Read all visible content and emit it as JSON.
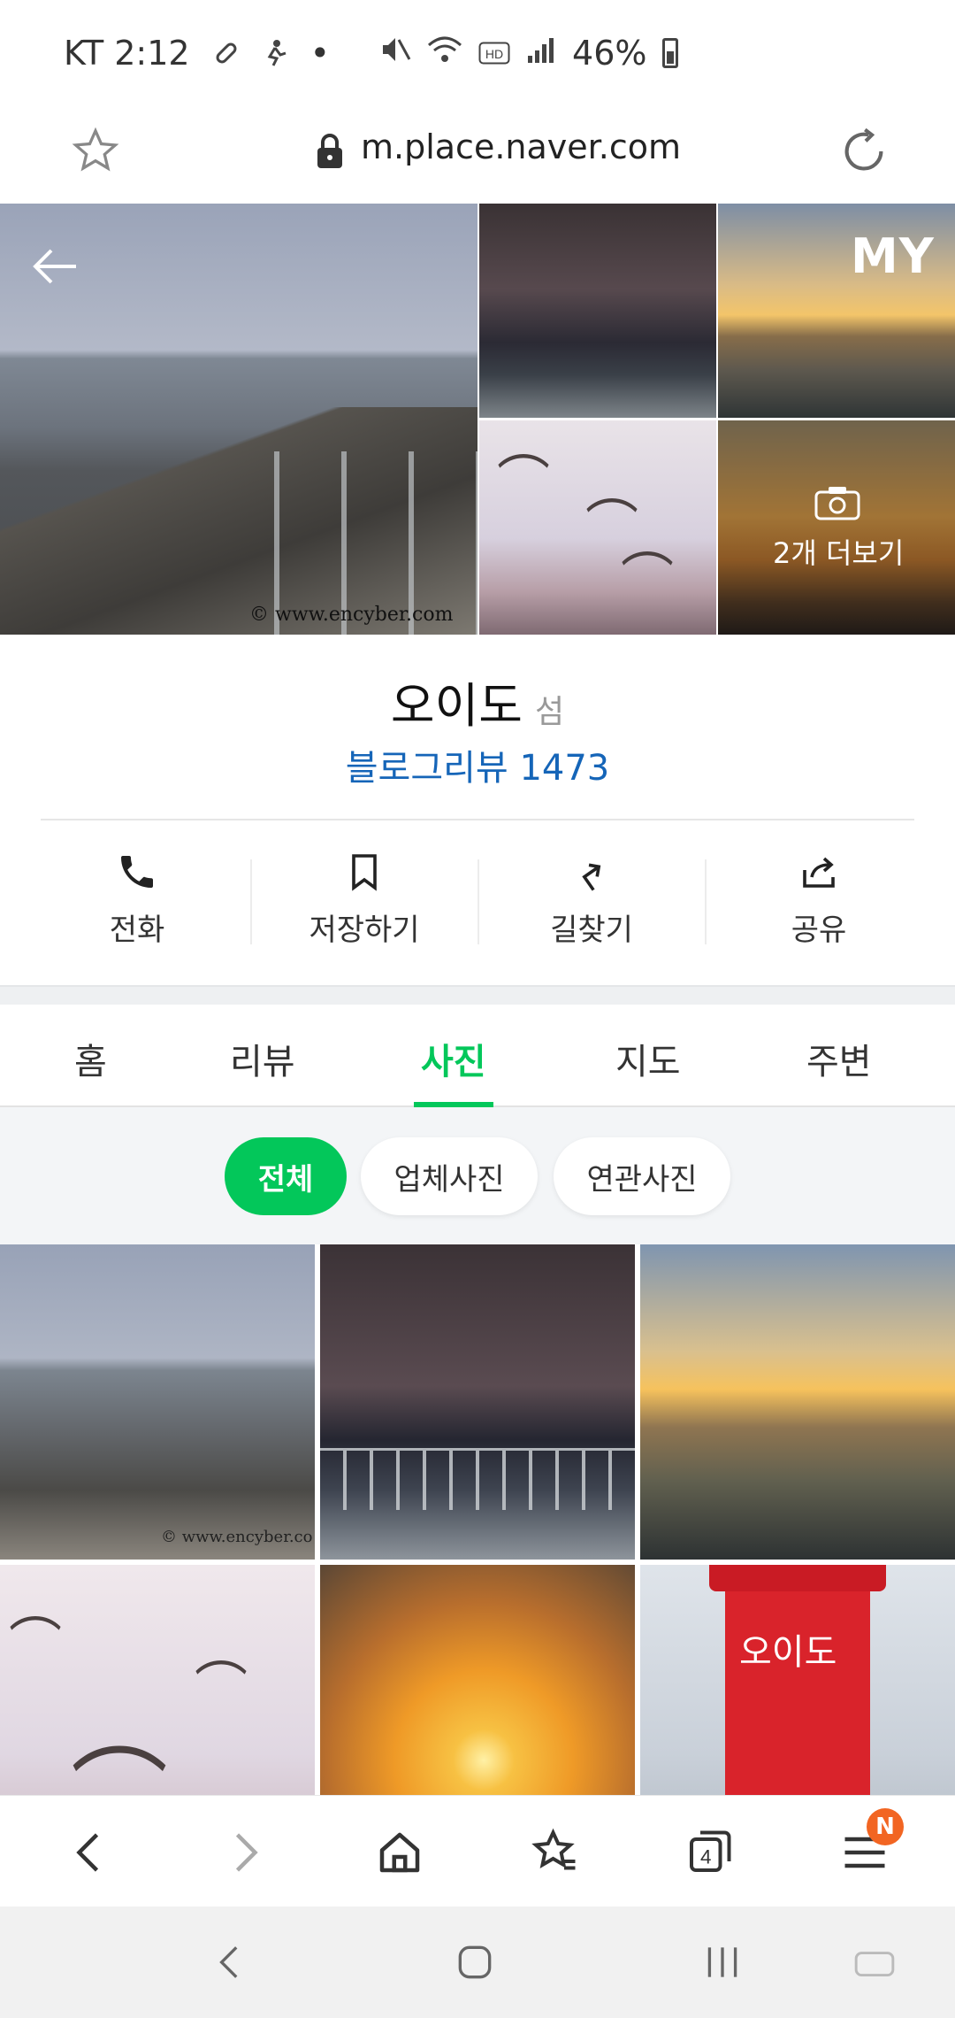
{
  "status_bar": {
    "carrier_time": "KT 2:12",
    "battery": "46%",
    "icons": [
      "clip-icon",
      "person-run-icon",
      "dot-icon",
      "mute-icon",
      "wifi-icon",
      "hd-icon",
      "signal-icon",
      "battery-icon"
    ]
  },
  "browser": {
    "url": "m.place.naver.com"
  },
  "gallery": {
    "my_label": "MY",
    "more_label": "2개 더보기",
    "watermark": "© www.encyber.com"
  },
  "place": {
    "name": "오이도",
    "category": "섬",
    "review_label": "블로그리뷰 1473"
  },
  "actions": [
    {
      "label": "전화",
      "icon": "phone-icon"
    },
    {
      "label": "저장하기",
      "icon": "bookmark-icon"
    },
    {
      "label": "길찾기",
      "icon": "directions-icon"
    },
    {
      "label": "공유",
      "icon": "share-icon"
    }
  ],
  "tabs": [
    {
      "label": "홈"
    },
    {
      "label": "리뷰"
    },
    {
      "label": "사진",
      "active": true
    },
    {
      "label": "지도"
    },
    {
      "label": "주변"
    }
  ],
  "filters": [
    {
      "label": "전체",
      "active": true
    },
    {
      "label": "업체사진"
    },
    {
      "label": "연관사진"
    }
  ],
  "grid_watermark": "© www.encyber.co",
  "grid_tower_text": "오이도",
  "bottom_bar": {
    "tabs_count": "4",
    "menu_badge": "N"
  },
  "colors": {
    "accent": "#03c75a",
    "link": "#1565b8",
    "badge": "#f26522"
  }
}
